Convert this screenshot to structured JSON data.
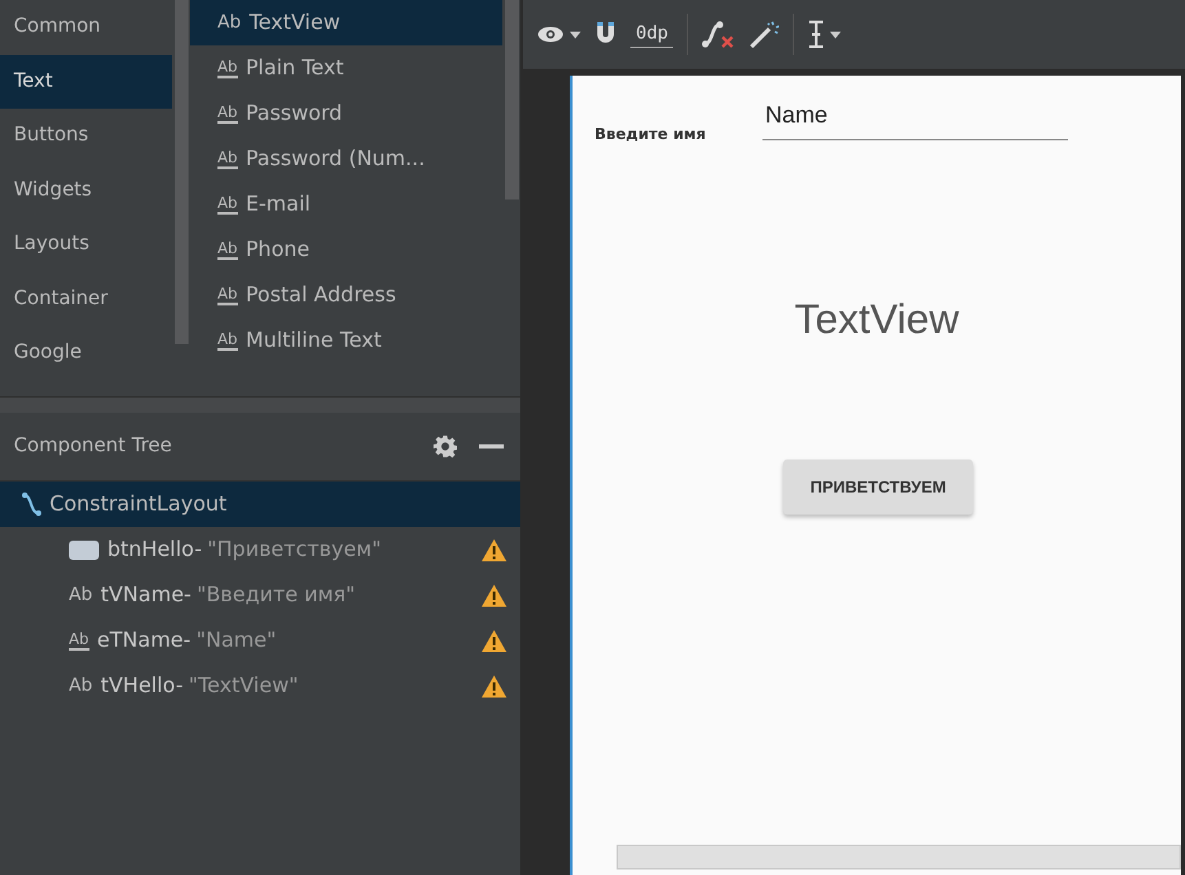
{
  "palette": {
    "categories": [
      {
        "label": "Common",
        "selected": false
      },
      {
        "label": "Text",
        "selected": true
      },
      {
        "label": "Buttons",
        "selected": false
      },
      {
        "label": "Widgets",
        "selected": false
      },
      {
        "label": "Layouts",
        "selected": false
      },
      {
        "label": "Container",
        "selected": false
      },
      {
        "label": "Google",
        "selected": false
      }
    ],
    "items": [
      {
        "kind": "textview",
        "icon": "Ab",
        "label": "TextView",
        "selected": true
      },
      {
        "kind": "edittext",
        "icon": "Ab",
        "label": "Plain Text",
        "selected": false
      },
      {
        "kind": "edittext",
        "icon": "Ab",
        "label": "Password",
        "selected": false
      },
      {
        "kind": "edittext",
        "icon": "Ab",
        "label": "Password (Num...",
        "selected": false
      },
      {
        "kind": "edittext",
        "icon": "Ab",
        "label": "E-mail",
        "selected": false
      },
      {
        "kind": "edittext",
        "icon": "Ab",
        "label": "Phone",
        "selected": false
      },
      {
        "kind": "edittext",
        "icon": "Ab",
        "label": "Postal Address",
        "selected": false
      },
      {
        "kind": "edittext",
        "icon": "Ab",
        "label": "Multiline Text",
        "selected": false
      }
    ]
  },
  "component_tree": {
    "title": "Component Tree",
    "root": {
      "label": "ConstraintLayout",
      "selected": true,
      "children": [
        {
          "kind": "button",
          "id": "btnHello-",
          "text": "\"Приветствуем\"",
          "warning": true
        },
        {
          "kind": "textview",
          "icon": "Ab",
          "id": "tVName-",
          "text": "\"Введите имя\"",
          "warning": true
        },
        {
          "kind": "edittext",
          "icon": "Ab",
          "id": "eTName-",
          "text": "\"Name\"",
          "warning": true
        },
        {
          "kind": "textview",
          "icon": "Ab",
          "id": "tVHello-",
          "text": "\"TextView\"",
          "warning": true
        }
      ]
    }
  },
  "toolbar": {
    "margin_label": "0dp"
  },
  "device": {
    "label": "Введите имя",
    "field_value": "Name",
    "text_view": "TextView",
    "button": "ПРИВЕТСТВУЕМ"
  }
}
